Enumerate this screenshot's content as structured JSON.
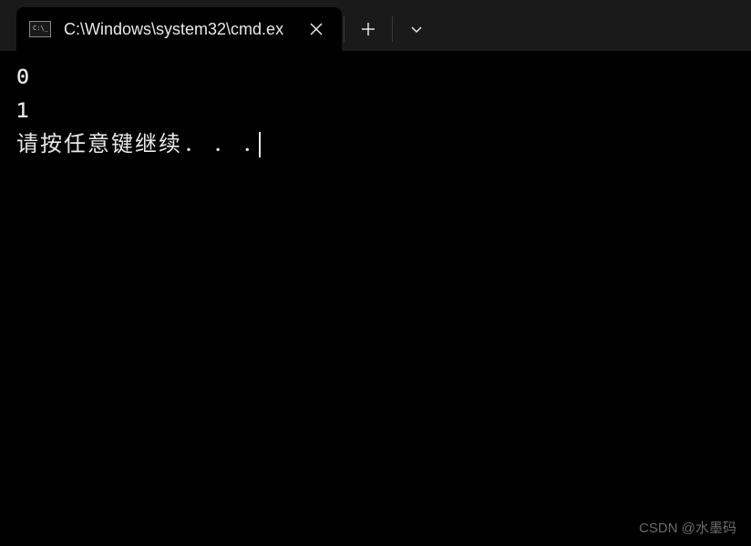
{
  "titlebar": {
    "tab": {
      "title": "C:\\Windows\\system32\\cmd.ex",
      "icon_name": "cmd-icon"
    },
    "actions": {
      "close_label": "close",
      "new_tab_label": "new tab",
      "dropdown_label": "tab options"
    }
  },
  "terminal": {
    "lines": [
      "0",
      "1"
    ],
    "prompt": "请按任意键继续. . . "
  },
  "watermark": "CSDN @水墨码"
}
